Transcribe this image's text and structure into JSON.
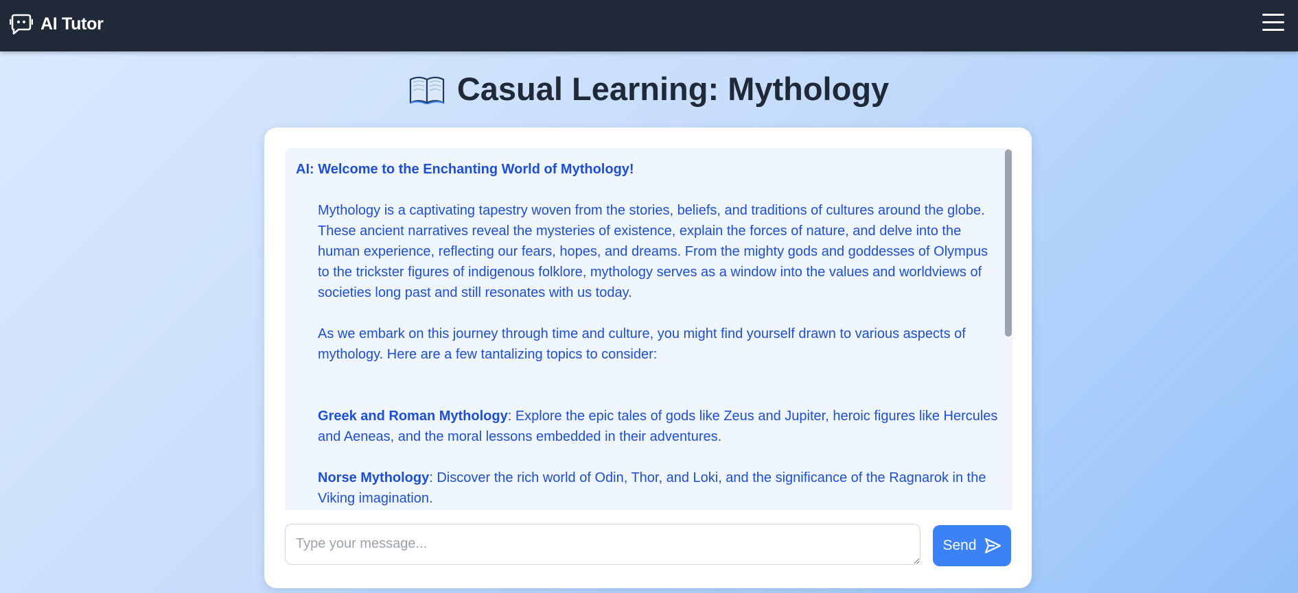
{
  "navbar": {
    "brand_icon": "chat-bot-icon",
    "brand_name": "AI Tutor",
    "menu_icon": "hamburger-menu-icon"
  },
  "page": {
    "title_icon": "open-book-icon",
    "title": "Casual Learning: Mythology"
  },
  "chat": {
    "message": {
      "heading": "AI: Welcome to the Enchanting World of Mythology!",
      "paragraphs": [
        "Mythology is a captivating tapestry woven from the stories, beliefs, and traditions of cultures around the globe. These ancient narratives reveal the mysteries of existence, explain the forces of nature, and delve into the human experience, reflecting our fears, hopes, and dreams. From the mighty gods and goddesses of Olympus to the trickster figures of indigenous folklore, mythology serves as a window into the values and worldviews of societies long past and still resonates with us today.",
        "As we embark on this journey through time and culture, you might find yourself drawn to various aspects of mythology. Here are a few tantalizing topics to consider:"
      ],
      "topics": [
        {
          "title": "Greek and Roman Mythology",
          "text": ": Explore the epic tales of gods like Zeus and Jupiter, heroic figures like Hercules and Aeneas, and the moral lessons embedded in their adventures."
        },
        {
          "title": "Norse Mythology",
          "text": ": Discover the rich world of Odin, Thor, and Loki, and the significance of the Ragnarok in the Viking imagination."
        }
      ]
    }
  },
  "composer": {
    "placeholder": "Type your message...",
    "send_label": "Send",
    "send_icon": "paper-plane-icon"
  },
  "colors": {
    "navbar_bg": "#1f2937",
    "accent": "#3b82f6",
    "message_text": "#1d4ed8",
    "chat_bg": "#eff6ff"
  }
}
